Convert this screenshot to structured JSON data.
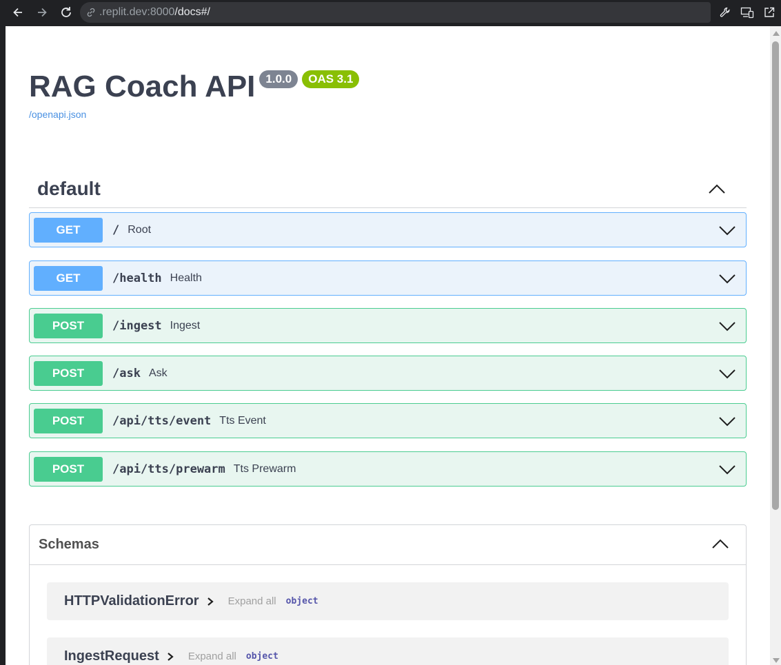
{
  "browser": {
    "url_host": ".replit.dev:8000",
    "url_path": "/docs#/"
  },
  "api": {
    "title": "RAG Coach API",
    "version": "1.0.0",
    "oas": "OAS 3.1",
    "spec_link": "/openapi.json"
  },
  "tag": {
    "name": "default"
  },
  "operations": [
    {
      "method": "GET",
      "path": "/",
      "summary": "Root"
    },
    {
      "method": "GET",
      "path": "/health",
      "summary": "Health"
    },
    {
      "method": "POST",
      "path": "/ingest",
      "summary": "Ingest"
    },
    {
      "method": "POST",
      "path": "/ask",
      "summary": "Ask"
    },
    {
      "method": "POST",
      "path": "/api/tts/event",
      "summary": "Tts Event"
    },
    {
      "method": "POST",
      "path": "/api/tts/prewarm",
      "summary": "Tts Prewarm"
    }
  ],
  "schemas": {
    "title": "Schemas",
    "models": [
      {
        "name": "HTTPValidationError",
        "expand": "Expand all",
        "type": "object"
      },
      {
        "name": "IngestRequest",
        "expand": "Expand all",
        "type": "object"
      }
    ]
  },
  "colors": {
    "get": "#61affe",
    "post": "#49cc90",
    "version_badge": "#7d8492",
    "oas_badge": "#89bf04",
    "link": "#4990e2"
  }
}
